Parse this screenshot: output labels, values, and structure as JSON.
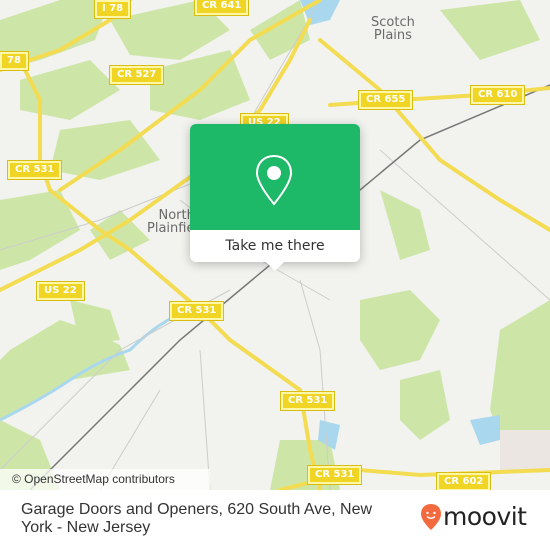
{
  "map": {
    "road_labels": [
      {
        "id": "i78-top",
        "text": "I 78"
      },
      {
        "id": "cr641",
        "text": "CR 641"
      },
      {
        "id": "i78-left",
        "text": "78"
      },
      {
        "id": "cr527",
        "text": "CR 527"
      },
      {
        "id": "us22-top",
        "text": "US 22"
      },
      {
        "id": "cr655",
        "text": "CR 655"
      },
      {
        "id": "cr610",
        "text": "CR 610"
      },
      {
        "id": "cr531-left",
        "text": "CR 531"
      },
      {
        "id": "us22-left",
        "text": "US 22"
      },
      {
        "id": "cr531-mid",
        "text": "CR 531"
      },
      {
        "id": "cr531-right",
        "text": "CR 531"
      },
      {
        "id": "cr531-bottom",
        "text": "CR 531"
      },
      {
        "id": "cr602",
        "text": "CR 602"
      }
    ],
    "place_labels": {
      "scotch_plains": "Scotch\nPlains",
      "north_plainfield": "North\nPlainfield"
    },
    "attribution": "© OpenStreetMap contributors",
    "colors": {
      "land": "#f2f2ee",
      "park": "#cde6a8",
      "water": "#a9d8ee",
      "road": "#f3dc52",
      "rail": "#777777"
    }
  },
  "popup": {
    "icon": "map-pin-icon",
    "button_label": "Take me there",
    "color": "#1db868"
  },
  "footer": {
    "title": "Garage Doors and Openers, 620 South Ave, New York - New Jersey",
    "brand": "moovit",
    "brand_color": "#f26a3e"
  }
}
